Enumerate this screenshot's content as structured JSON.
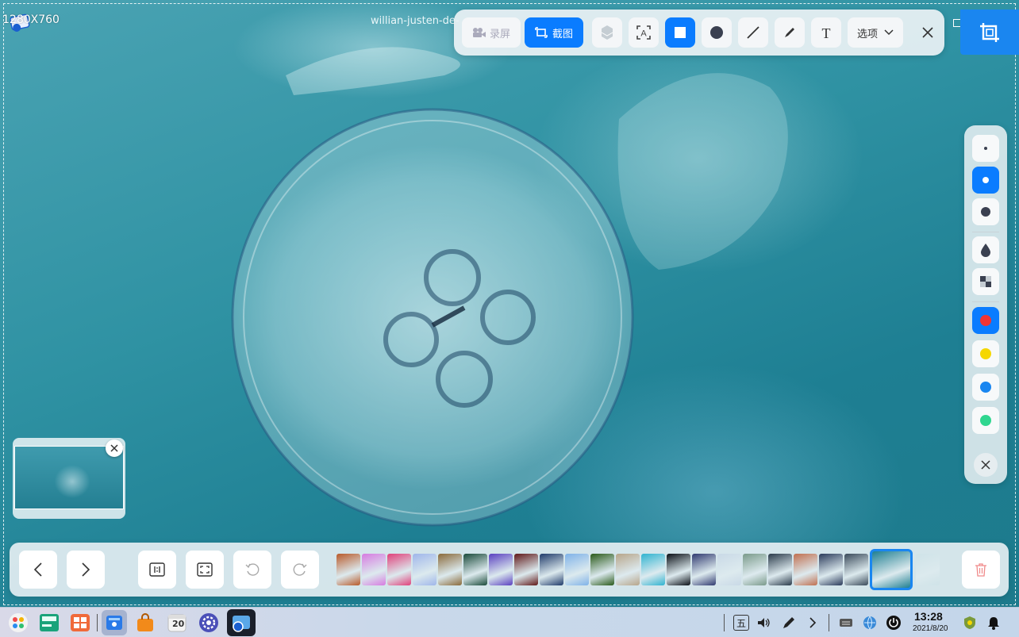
{
  "capture": {
    "size_label": "1280X760",
    "file_name": "willian-justen-de-"
  },
  "toolbar": {
    "record_label": "录屏",
    "screenshot_label": "截图",
    "options_label": "选项"
  },
  "side_panel": {
    "colors": [
      "#f03434",
      "#f5d700",
      "#1a86f0",
      "#2fd68f"
    ],
    "accent": "#0a7cff"
  },
  "filmstrip": {
    "thumbnail_colors": [
      "#b85a2a",
      "#d67be0",
      "#e0407a",
      "#9fb6ea",
      "#8a6a3a",
      "#1a4a3a",
      "#5a40c0",
      "#601818",
      "#1f3a6a",
      "#7fb2e8",
      "#2a5a1a",
      "#b7a58a",
      "#2fb3d0",
      "#0a0f16",
      "#303a70",
      "#c9d9e6",
      "#7a9a8a",
      "#2a3a4a",
      "#c07050",
      "#2a3a5a",
      "#3a4a5a",
      "#1f7f92",
      "#cfe3e8"
    ],
    "selected_index": 21
  },
  "taskbar": {
    "calendar_day": "20",
    "ime_label": "五",
    "time": "13:28",
    "date": "2021/8/20"
  }
}
